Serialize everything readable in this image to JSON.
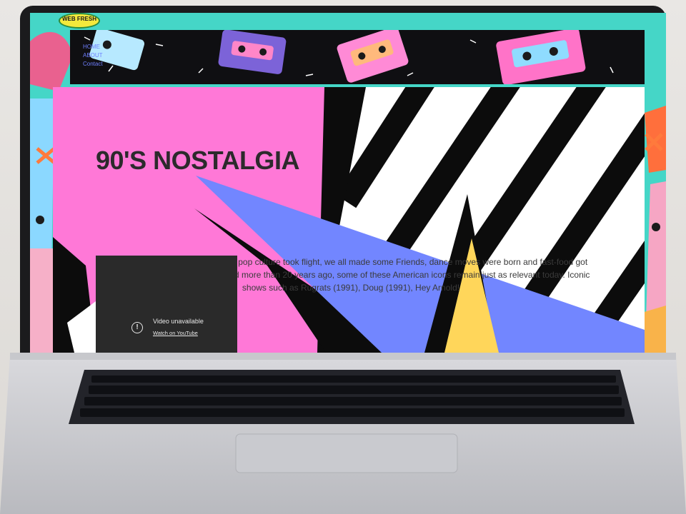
{
  "site": {
    "logo_text": "WEB\nFRESH",
    "nav": {
      "items": [
        "HOME",
        "ABOUT",
        "Contact"
      ]
    }
  },
  "hero": {
    "title": "90'S NOSTALGIA",
    "paragraph": "The 1990s was a decade where pop culture took flight, we all made some Friends, dance moves were born and fast-food got even bigger. Although they ended more than 20 years ago, some of these American icons remain just as relevant today. Iconic shows such as Rugrats (1991), Doug (1991), Hey Arnold!"
  },
  "video": {
    "status": "Video unavailable",
    "link_label": "Watch on YouTube",
    "icon": "alert-circle-icon"
  },
  "colors": {
    "pink": "#ff78d7",
    "periwinkle": "#7286ff",
    "yellow": "#ffd65a",
    "teal": "#45d6c7",
    "black": "#0c0c0c",
    "white": "#ffffff"
  }
}
